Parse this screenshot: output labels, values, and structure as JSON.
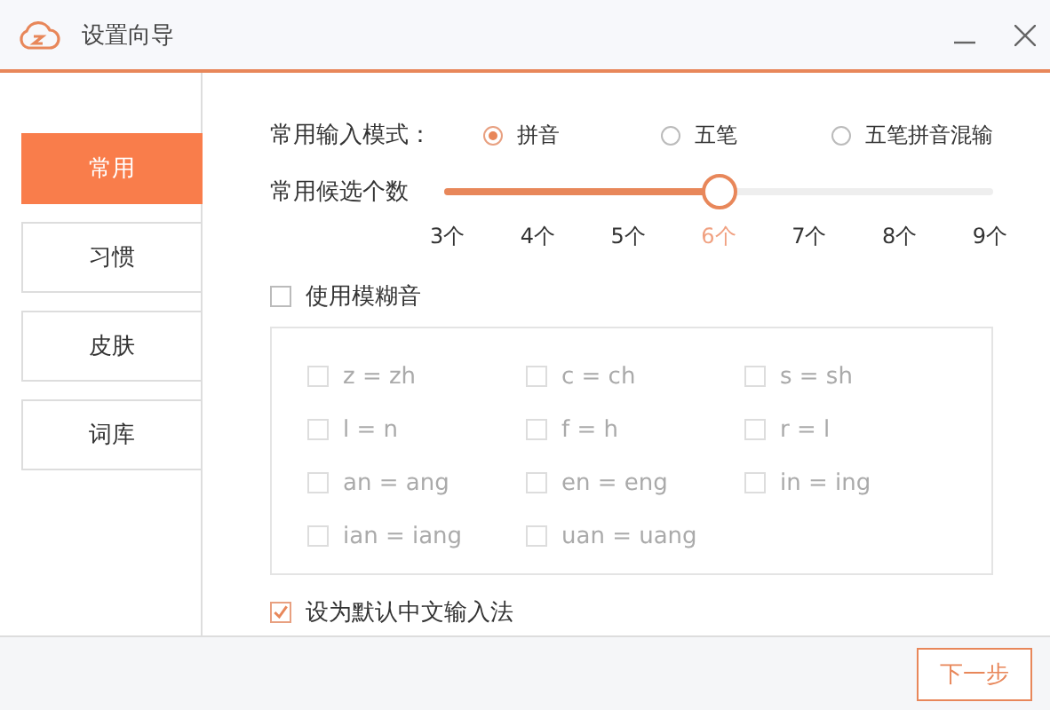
{
  "window": {
    "title": "设置向导"
  },
  "sidebar": {
    "items": [
      {
        "label": "常用",
        "selected": true
      },
      {
        "label": "习惯",
        "selected": false
      },
      {
        "label": "皮肤",
        "selected": false
      },
      {
        "label": "词库",
        "selected": false
      }
    ]
  },
  "input_mode": {
    "label": "常用输入模式：",
    "options": [
      {
        "label": "拼音",
        "selected": true
      },
      {
        "label": "五笔",
        "selected": false
      },
      {
        "label": "五笔拼音混输",
        "selected": false
      }
    ]
  },
  "candidates": {
    "label": "常用候选个数",
    "level": 0.5,
    "ticks": [
      {
        "label": "3个",
        "selected": false
      },
      {
        "label": "4个",
        "selected": false
      },
      {
        "label": "5个",
        "selected": false
      },
      {
        "label": "6个",
        "selected": true
      },
      {
        "label": "7个",
        "selected": false
      },
      {
        "label": "8个",
        "selected": false
      },
      {
        "label": "9个",
        "selected": false
      }
    ]
  },
  "fuzzy": {
    "label": "使用模糊音",
    "checked": false,
    "options": [
      {
        "label": "z = zh",
        "checked": false
      },
      {
        "label": "c = ch",
        "checked": false
      },
      {
        "label": "s = sh",
        "checked": false
      },
      {
        "label": "l = n",
        "checked": false
      },
      {
        "label": "f = h",
        "checked": false
      },
      {
        "label": "r = l",
        "checked": false
      },
      {
        "label": "an = ang",
        "checked": false
      },
      {
        "label": "en = eng",
        "checked": false
      },
      {
        "label": "in = ing",
        "checked": false
      },
      {
        "label": "ian = iang",
        "checked": false
      },
      {
        "label": "uan = uang",
        "checked": false
      }
    ]
  },
  "default_ime": {
    "label": "设为默认中文输入法",
    "checked": true
  },
  "footer": {
    "button": "下一步"
  }
}
